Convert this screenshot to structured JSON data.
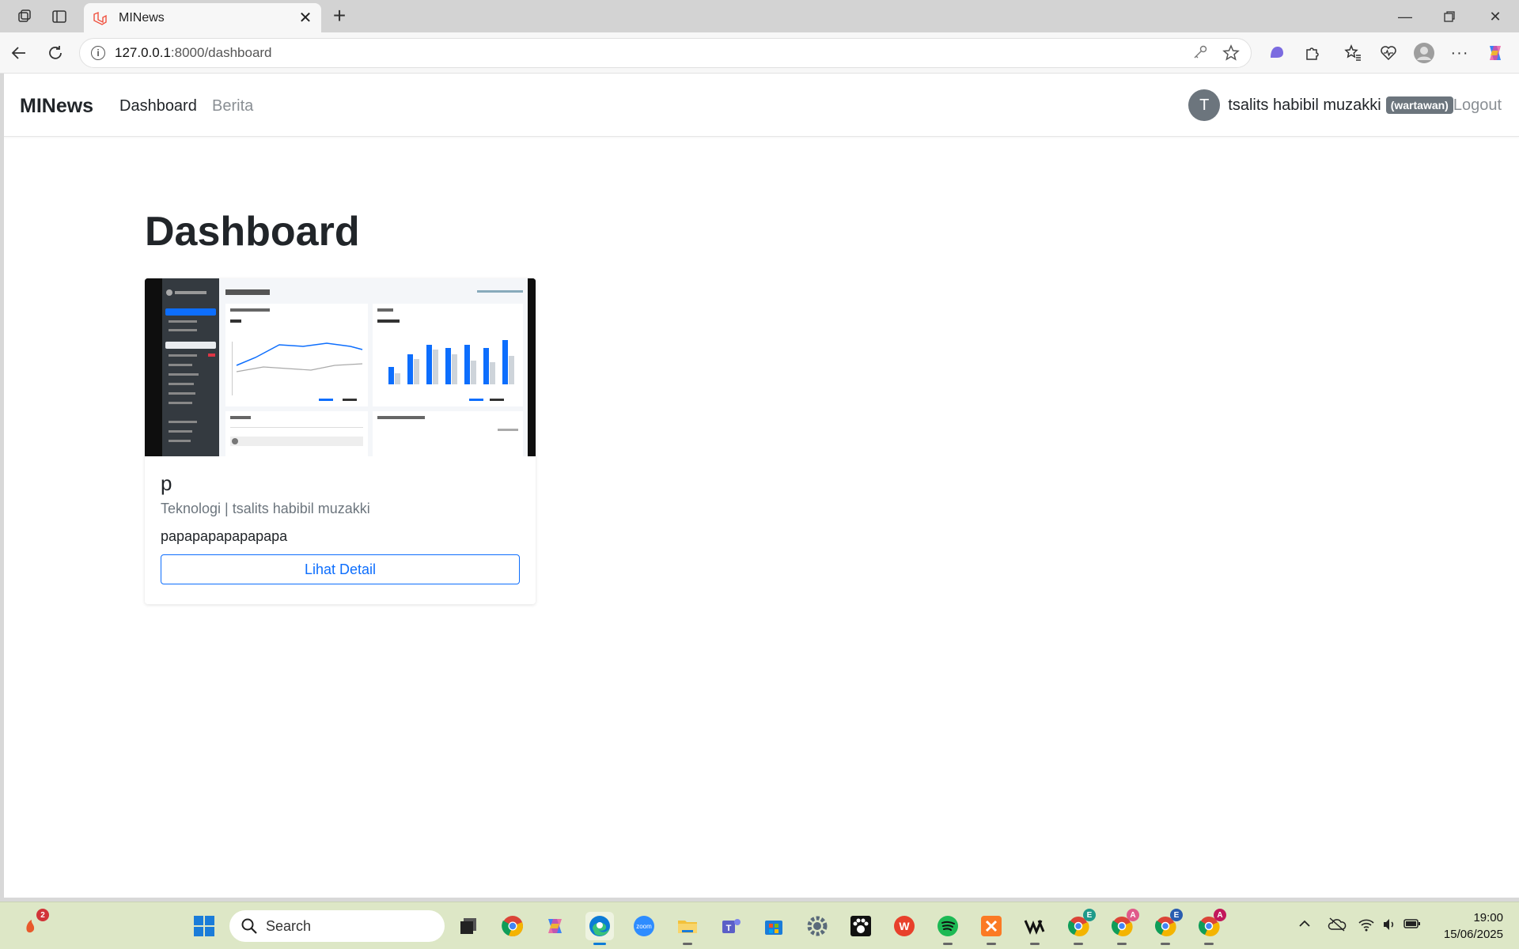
{
  "browser": {
    "tab_title": "MINews",
    "url_host": "127.0.0.1",
    "url_path": ":8000/dashboard"
  },
  "navbar": {
    "brand": "MINews",
    "links": [
      "Dashboard",
      "Berita"
    ],
    "user_initial": "T",
    "user_name": "tsalits habibil muzakki",
    "role": "(wartawan)",
    "logout": "Logout"
  },
  "main": {
    "title": "Dashboard",
    "cards": [
      {
        "title": "p",
        "meta": "Teknologi | tsalits habibil muzakki",
        "excerpt": "papapapapapapapa",
        "button": "Lihat Detail"
      }
    ]
  },
  "taskbar": {
    "search_label": "Search",
    "time": "19:00",
    "date": "15/06/2025",
    "notif_count": "2"
  },
  "colors": {
    "primary": "#0d6efd",
    "secondary": "#6c757d",
    "taskbar": "#dde7c6"
  }
}
